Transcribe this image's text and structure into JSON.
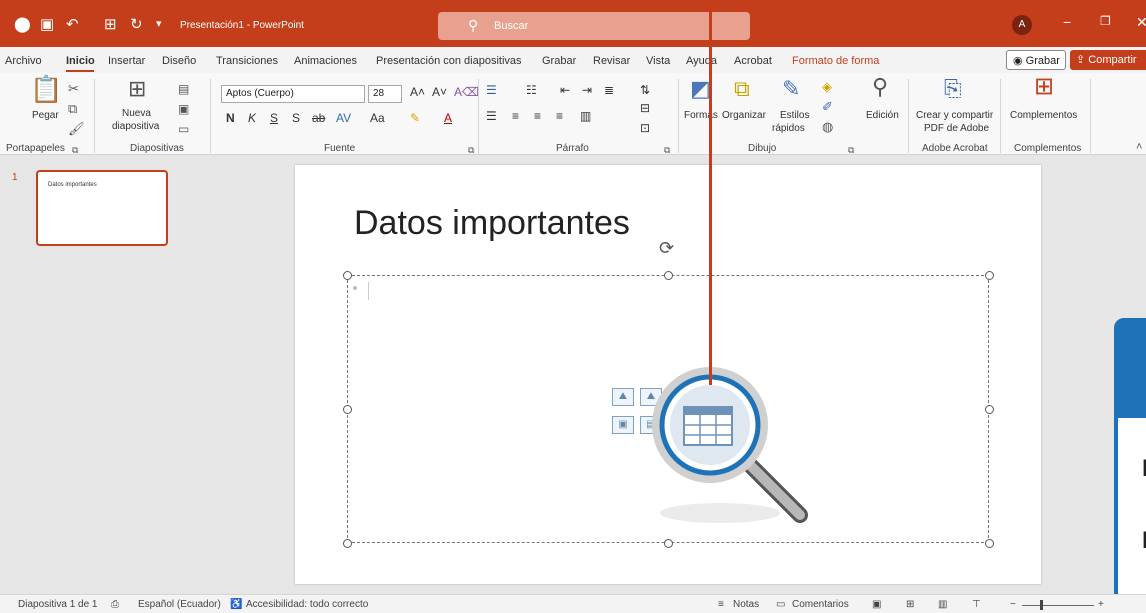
{
  "titlebar": {
    "doc_title": "Presentación1 - PowerPoint",
    "search_placeholder": "Buscar",
    "avatar_initial": "A",
    "app_icon": "powerpoint-logo-icon",
    "accent_color": "#c43e1c"
  },
  "tabs": [
    {
      "label": "Archivo"
    },
    {
      "label": "Inicio"
    },
    {
      "label": "Insertar"
    },
    {
      "label": "Diseño"
    },
    {
      "label": "Transiciones"
    },
    {
      "label": "Animaciones"
    },
    {
      "label": "Presentación con diapositivas"
    },
    {
      "label": "Grabar"
    },
    {
      "label": "Revisar"
    },
    {
      "label": "Vista"
    },
    {
      "label": "Ayuda"
    },
    {
      "label": "Acrobat"
    },
    {
      "label": "Formato de forma"
    }
  ],
  "header_buttons": {
    "record": "Grabar",
    "share": "Compartir"
  },
  "ribbon": {
    "paste": "Pegar",
    "new_slide_line1": "Nueva",
    "new_slide_line2": "diapositiva",
    "font_name": "Aptos (Cuerpo)",
    "font_size": "28",
    "bold": "N",
    "italic": "K",
    "underline": "S",
    "shadow": "S",
    "strike": "ab",
    "case": "Aa",
    "shapes": "Formas",
    "arrange": "Organizar",
    "styles_line1": "Estilos",
    "styles_line2": "rápidos",
    "editing": "Edición",
    "adobe_line1": "Crear y compartir",
    "adobe_line2": "PDF de Adobe",
    "addins": "Complementos",
    "groups": {
      "clipboard": "Portapapeles",
      "slides": "Diapositivas",
      "font": "Fuente",
      "paragraph": "Párrafo",
      "drawing": "Dibujo",
      "acrobat": "Adobe Acrobat",
      "addins": "Complementos"
    }
  },
  "thumbnails": [
    {
      "number": "1",
      "title": "Datos importantes"
    }
  ],
  "slide": {
    "title": "Datos importantes"
  },
  "side_panel": {
    "line1": "N",
    "line2": "N",
    "color": "#1e73b8"
  },
  "status": {
    "slide_count": "Diapositiva 1 de 1",
    "language": "Español (Ecuador)",
    "accessibility": "Accesibilidad: todo correcto",
    "notes": "Notas",
    "comments": "Comentarios"
  }
}
